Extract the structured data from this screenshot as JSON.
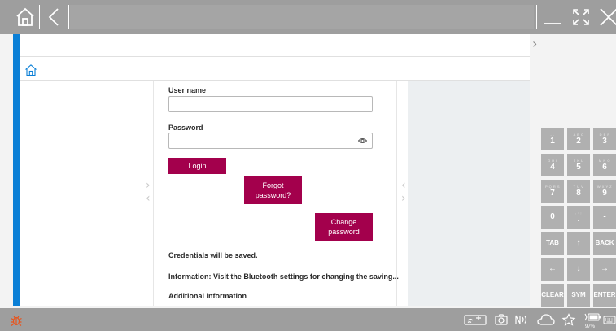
{
  "titlebar": {
    "home_icon": "home-icon",
    "back_icon": "chevron-left-icon",
    "minimize_icon": "minimize-icon",
    "maximize_icon": "maximize-icon",
    "close_icon": "close-icon"
  },
  "breadcrumb": {
    "home_icon": "home-outline-icon"
  },
  "login_form": {
    "username_label": "User name",
    "username_value": "",
    "password_label": "Password",
    "password_value": "",
    "login_button": "Login",
    "forgot_password_line1": "Forgot",
    "forgot_password_line2": "password?",
    "change_password_line1": "Change",
    "change_password_line2": "password",
    "credentials_text": "Credentials will be saved.",
    "information_text": "Information: Visit the Bluetooth settings for changing the saving...",
    "additional_info_text": "Additional information"
  },
  "keypad": {
    "keys": [
      {
        "sub": "- .",
        "main": "1"
      },
      {
        "sub": "A B C",
        "main": "2"
      },
      {
        "sub": "D E F",
        "main": "3"
      },
      {
        "sub": "G H I",
        "main": "4"
      },
      {
        "sub": "J K L",
        "main": "5"
      },
      {
        "sub": "M N O",
        "main": "6"
      },
      {
        "sub": "P Q R S",
        "main": "7"
      },
      {
        "sub": "T U V",
        "main": "8"
      },
      {
        "sub": "W X Y Z",
        "main": "9"
      },
      {
        "sub": "",
        "main": "0"
      },
      {
        "sub": ", : ;",
        "main": "."
      },
      {
        "sub": "",
        "main": "-"
      },
      {
        "sub": "",
        "main": "TAB"
      },
      {
        "sub": "",
        "main": "↑"
      },
      {
        "sub": "",
        "main": "BACK"
      },
      {
        "sub": "",
        "main": "←"
      },
      {
        "sub": "",
        "main": "↓"
      },
      {
        "sub": "",
        "main": "→"
      },
      {
        "sub": "",
        "main": "CLEAR"
      },
      {
        "sub": "",
        "main": "SYM"
      },
      {
        "sub": "",
        "main": "ENTER"
      }
    ]
  },
  "taskbar": {
    "battery_percent": "97%",
    "icons": [
      "bug-icon",
      "cast-icon",
      "camera-icon",
      "nfc-icon",
      "cloud-icon",
      "star-icon",
      "battery-icon",
      "keyboard-icon"
    ]
  },
  "colors": {
    "accent_blue": "#0a7fd6",
    "button_magenta": "#a3004c",
    "bar_gray": "#9e9e9e",
    "bug_orange": "#e8541d"
  }
}
